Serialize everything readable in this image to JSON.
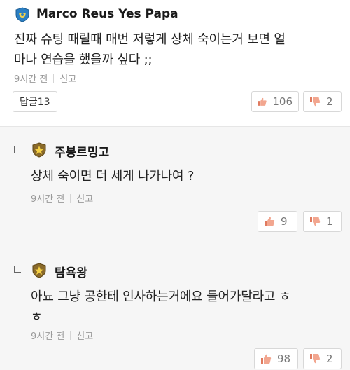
{
  "comment": {
    "author": "Marco Reus Yes Papa",
    "text_line1": "진짜 슈팅 때릴때 매번 저렇게 상체 숙이는거 보면 얼",
    "text_line2": "마나 연습을 했을까 싶다 ;;",
    "time": "9시간 전",
    "report": "신고",
    "reply_button": "답글13",
    "likes": "106",
    "dislikes": "2",
    "badge_color": "#2a7fc4"
  },
  "replies": [
    {
      "author": "주봉르밍고",
      "text_line1": "상체 숙이면 더 세게 나가나여 ?",
      "time": "9시간 전",
      "report": "신고",
      "likes": "9",
      "dislikes": "1",
      "badge_color": "#8a6a2a"
    },
    {
      "author": "탐욕왕",
      "text_line1": "아뇨 그냥 공한테 인사하는거에요 들어가달라고 ㅎ",
      "text_line2": "ㅎ",
      "time": "9시간 전",
      "report": "신고",
      "likes": "98",
      "dislikes": "2",
      "badge_color": "#8a6a2a"
    }
  ]
}
